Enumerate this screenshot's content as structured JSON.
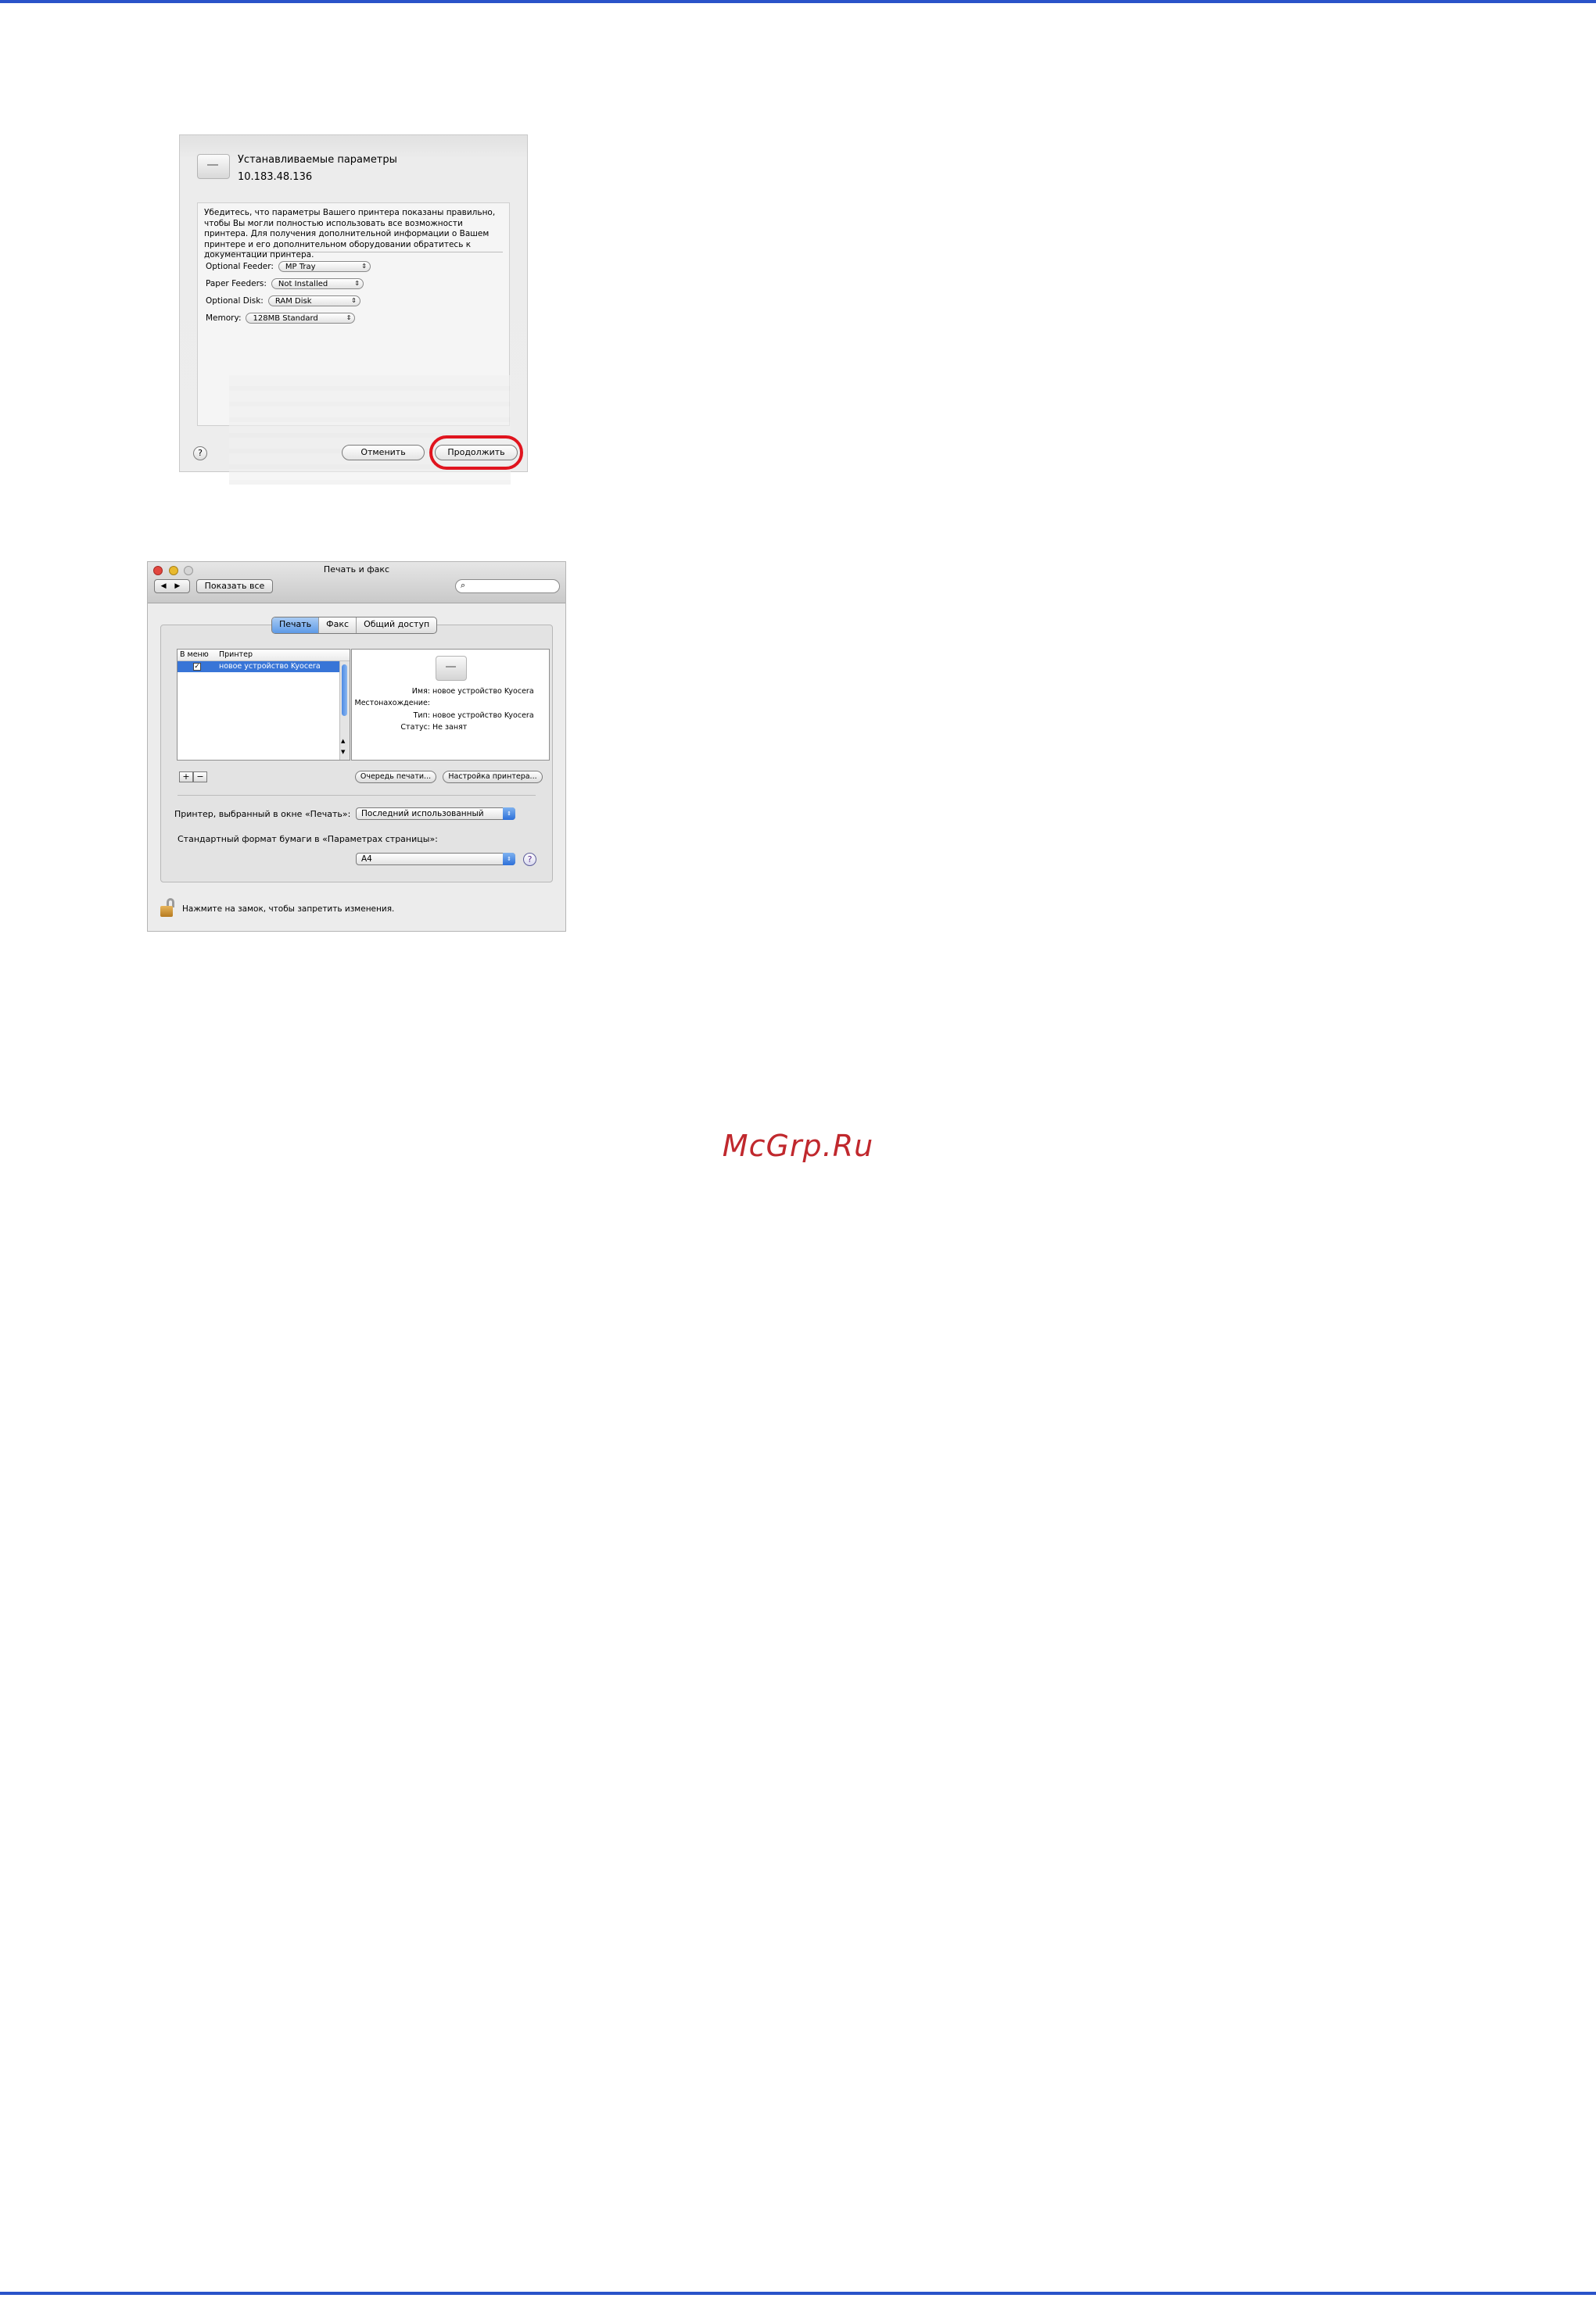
{
  "colors": {
    "rule": "#2a53c9",
    "highlight": "#e0141e",
    "selection": "#3875d7",
    "watermark": "#c0282d"
  },
  "installable_options": {
    "title": "Устанавливаемые параметры",
    "ip": "10.183.48.136",
    "description": "Убедитесь, что параметры Вашего принтера показаны правильно, чтобы Вы могли полностью использовать все возможности принтера. Для получения дополнительной информации о Вашем принтере и его дополнительном оборудовании обратитесь к документации принтера.",
    "options": [
      {
        "label": "Optional Feeder:",
        "value": "MP Tray"
      },
      {
        "label": "Paper Feeders:",
        "value": "Not Installed"
      },
      {
        "label": "Optional Disk:",
        "value": "RAM Disk"
      },
      {
        "label": "Memory:",
        "value": "128MB Standard"
      }
    ],
    "help": "?",
    "cancel_label": "Отменить",
    "continue_label": "Продолжить"
  },
  "print_fax": {
    "window_title": "Печать и факс",
    "nav_arrows": "◀ ▶",
    "show_all_label": "Показать все",
    "search_icon": "magnifier-icon",
    "tabs": [
      {
        "label": "Печать",
        "active": true
      },
      {
        "label": "Факс",
        "active": false
      },
      {
        "label": "Общий доступ",
        "active": false
      }
    ],
    "list_headers": {
      "in_menu": "В меню",
      "printer": "Принтер"
    },
    "printers": [
      {
        "checked": "✓",
        "name": "новое устройство Kyocera"
      }
    ],
    "details": {
      "name_key": "Имя:",
      "name_value": "новое устройство Kyocera",
      "location_key": "Местонахождение:",
      "location_value": "",
      "type_key": "Тип:",
      "type_value": "новое устройство Kyocera",
      "status_key": "Статус:",
      "status_value": "Не занят"
    },
    "add_label": "+",
    "remove_label": "−",
    "queue_label": "Очередь печати...",
    "setup_label": "Настройка принтера...",
    "selected_printer_label": "Принтер, выбранный в окне «Печать»:",
    "selected_printer_value": "Последний использованный",
    "paper_size_label": "Стандартный формат бумаги в «Параметрах страницы»:",
    "paper_size_value": "A4",
    "help": "?",
    "lock_text": "Нажмите на замок, чтобы запретить изменения."
  },
  "watermark": "McGrp.Ru"
}
